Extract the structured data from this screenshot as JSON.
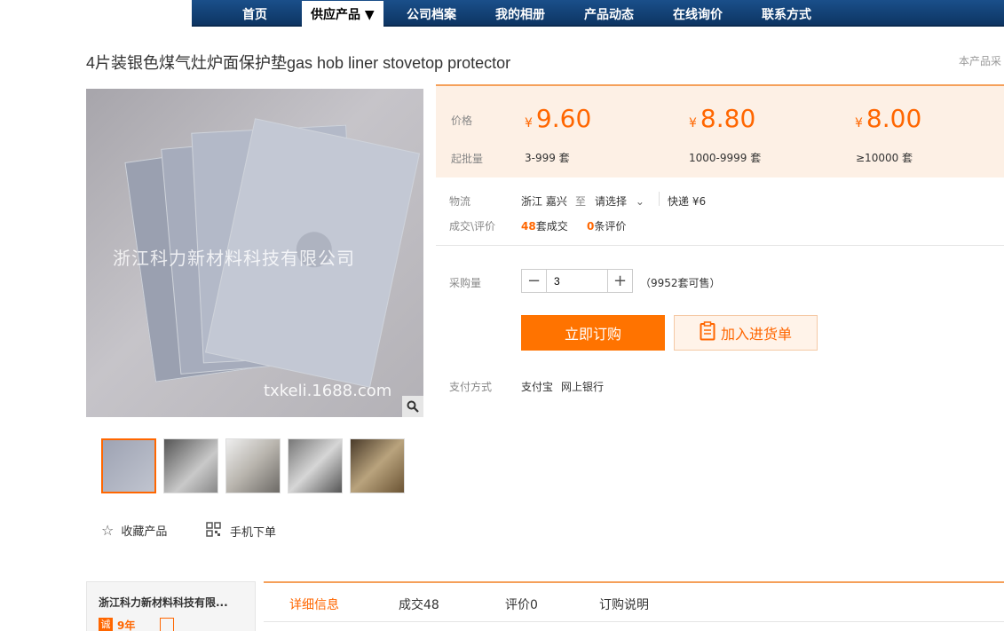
{
  "nav": {
    "items": [
      "首页",
      "供应产品 ▼",
      "公司档案",
      "我的相册",
      "产品动态",
      "在线询价",
      "联系方式"
    ]
  },
  "product": {
    "title": "4片装银色煤气灶炉面保护垫gas hob liner stovetop protector",
    "right_note": "本产品采"
  },
  "image": {
    "watermark": "浙江科力新材料科技有限公司",
    "site": "txkeli.1688.com"
  },
  "actions": {
    "favorite": "收藏产品",
    "mobile_order": "手机下单"
  },
  "pricing": {
    "price_label": "价格",
    "moq_label": "起批量",
    "currency": "¥",
    "tiers": [
      {
        "price": "9.60",
        "range": "3-999 套"
      },
      {
        "price": "8.80",
        "range": "1000-9999 套"
      },
      {
        "price": "8.00",
        "range": "≥10000 套"
      }
    ]
  },
  "logistics": {
    "label": "物流",
    "origin": "浙江 嘉兴",
    "to": "至",
    "select": "请选择",
    "express": "快递 ¥6"
  },
  "deals": {
    "label": "成交\\评价",
    "deal_count": "48",
    "deal_suffix": "套成交",
    "review_count": "0",
    "review_suffix": "条评价"
  },
  "purchase": {
    "label": "采购量",
    "quantity": "3",
    "available": "（9952套可售）",
    "buy_now": "立即订购",
    "add_cart": "加入进货单"
  },
  "payment": {
    "label": "支付方式",
    "methods": [
      "支付宝",
      "网上银行"
    ]
  },
  "company": {
    "name": "浙江科力新材料科技有限...",
    "years": "9年"
  },
  "tabs": [
    "详细信息",
    "成交48",
    "评价0",
    "订购说明"
  ],
  "colors": {
    "accent": "#ff7300",
    "nav": "#1a4f8a",
    "price_bg": "#fdf0e5"
  }
}
